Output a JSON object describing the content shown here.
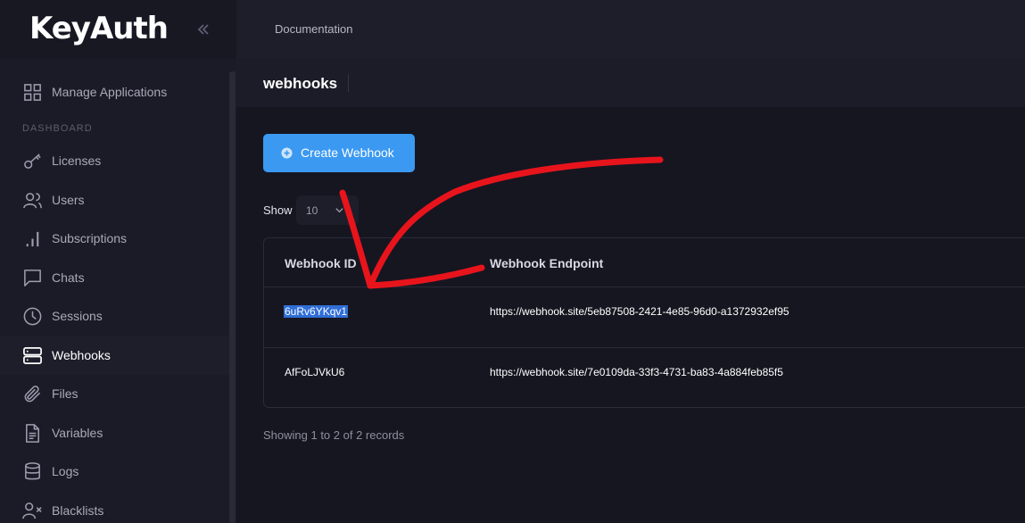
{
  "app": {
    "logo": "KeyAuth"
  },
  "topbar": {
    "doc_link": "Documentation"
  },
  "sidebar": {
    "heading": "DASHBOARD",
    "items": [
      {
        "label": "Manage Applications",
        "icon": "grid-icon"
      },
      {
        "label": "Licenses",
        "icon": "key-icon"
      },
      {
        "label": "Users",
        "icon": "users-icon"
      },
      {
        "label": "Subscriptions",
        "icon": "bar-chart-icon"
      },
      {
        "label": "Chats",
        "icon": "chat-icon"
      },
      {
        "label": "Sessions",
        "icon": "clock-icon"
      },
      {
        "label": "Webhooks",
        "icon": "server-icon",
        "active": true
      },
      {
        "label": "Files",
        "icon": "paperclip-icon"
      },
      {
        "label": "Variables",
        "icon": "document-icon"
      },
      {
        "label": "Logs",
        "icon": "database-icon"
      },
      {
        "label": "Blacklists",
        "icon": "user-x-icon"
      }
    ]
  },
  "page": {
    "title": "webhooks"
  },
  "main": {
    "create_button": "Create Webhook",
    "show_label": "Show",
    "page_size": "10",
    "records": "Showing 1 to 2 of 2 records"
  },
  "table": {
    "headers": [
      "Webhook ID",
      "Webhook Endpoint"
    ],
    "rows": [
      {
        "id": "6uRv6YKqv1",
        "endpoint": "https://webhook.site/5eb87508-2421-4e85-96d0-a1372932ef95",
        "selected": true
      },
      {
        "id": "AfFoLJVkU6",
        "endpoint": "https://webhook.site/7e0109da-33f3-4731-ba83-4a884feb85f5"
      }
    ]
  },
  "colors": {
    "accent": "#3b99f1",
    "annotation": "#e8141c",
    "background": "#161621",
    "sidebar": "#1b1b27"
  }
}
